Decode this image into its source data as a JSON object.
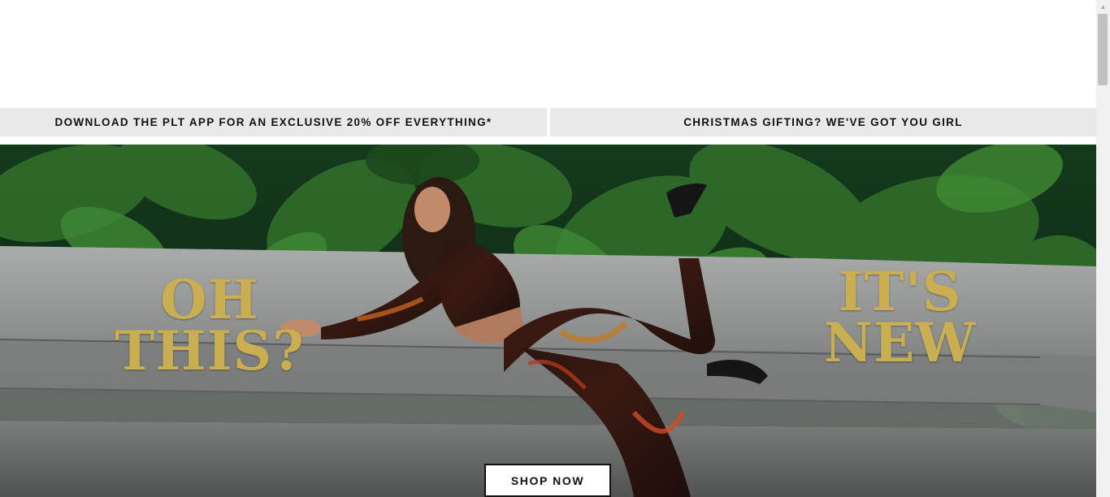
{
  "promos": {
    "left": "DOWNLOAD THE PLT APP FOR AN EXCLUSIVE 20% OFF EVERYTHING*",
    "right": "CHRISTMAS GIFTING? WE'VE GOT YOU GIRL"
  },
  "hero": {
    "headline_left": [
      "OH",
      "THIS?"
    ],
    "headline_right": [
      "IT'S",
      "NEW"
    ],
    "cta_label": "SHOP NOW",
    "headline_color": "#c9ae52"
  },
  "scrollbar": {
    "up_arrow_icon": "triangle-up-icon"
  }
}
